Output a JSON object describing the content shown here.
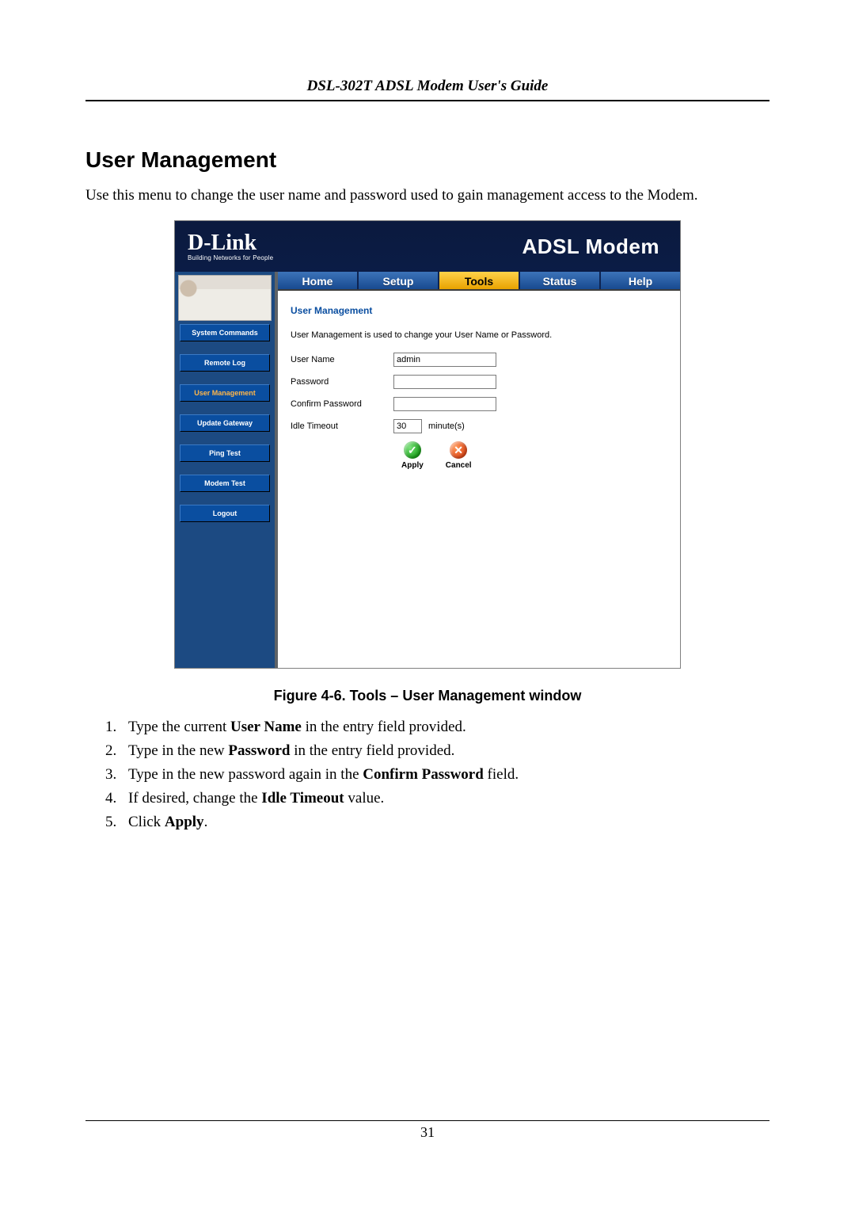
{
  "doc": {
    "running_header": "DSL-302T ADSL Modem User's Guide",
    "section_title": "User Management",
    "intro": "Use this menu to change the user name and password used to gain management access to the Modem.",
    "figure_caption": "Figure 4-6. Tools – User Management window",
    "page_number": "31"
  },
  "steps": [
    {
      "pre": "Type the current ",
      "bold": "User Name",
      "post": " in the entry field provided."
    },
    {
      "pre": "Type in the new ",
      "bold": "Password",
      "post": " in the entry field provided."
    },
    {
      "pre": "Type in the new password again in the ",
      "bold": "Confirm Password",
      "post": " field."
    },
    {
      "pre": "If desired, change the ",
      "bold": "Idle Timeout",
      "post": " value."
    },
    {
      "pre": "Click ",
      "bold": "Apply",
      "post": "."
    }
  ],
  "ui": {
    "logo_brand": "D-Link",
    "logo_tag": "Building Networks for People",
    "header_title": "ADSL Modem",
    "tabs": [
      "Home",
      "Setup",
      "Tools",
      "Status",
      "Help"
    ],
    "active_tab_index": 2,
    "sidebar": [
      "System Commands",
      "Remote Log",
      "User Management",
      "Update Gateway",
      "Ping Test",
      "Modem Test",
      "Logout"
    ],
    "active_sidebar_index": 2,
    "panel": {
      "title": "User Management",
      "description": "User Management is used to change your User Name or Password.",
      "username_label": "User Name",
      "username_value": "admin",
      "password_label": "Password",
      "password_value": "",
      "confirm_label": "Confirm Password",
      "confirm_value": "",
      "idle_label": "Idle Timeout",
      "idle_value": "30",
      "idle_unit": "minute(s)",
      "apply_label": "Apply",
      "cancel_label": "Cancel"
    }
  }
}
